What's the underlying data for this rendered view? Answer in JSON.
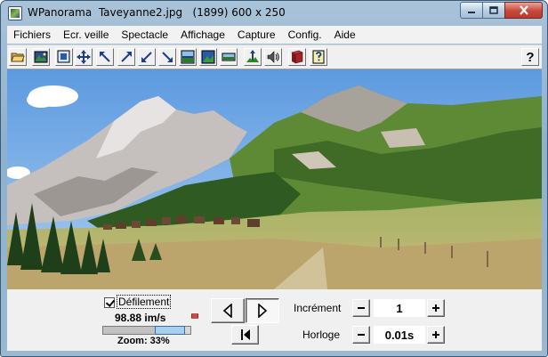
{
  "window": {
    "title": "WPanorama  Taveyanne2.jpg   (1899) 600 x 250",
    "icon": "wpanorama-app-icon"
  },
  "menu": [
    "Fichiers",
    "Ecr. veille",
    "Spectacle",
    "Affichage",
    "Capture",
    "Config.",
    "Aide"
  ],
  "toolbar": {
    "buttons": [
      "open-folder-icon",
      "landscape-image-icon",
      "fit-window-icon",
      "move-arrows-icon",
      "scroll-up-left-icon",
      "scroll-up-right-icon",
      "scroll-down-left-icon",
      "scroll-down-right-icon",
      "image-bottom-icon",
      "image-full-icon",
      "image-strip-icon",
      "adjust-levels-icon",
      "sound-icon",
      "book-icon",
      "help-file-icon"
    ],
    "help_button": "?"
  },
  "panorama": {
    "image": "alpine-valley-panorama-icon"
  },
  "controls": {
    "scroll_checkbox_label": "Défilement",
    "scroll_checked": true,
    "speed": "98.88 im/s",
    "zoom_label": "Zoom: 33%",
    "zoom_fraction": 0.33,
    "increment_label": "Incrément",
    "increment_value": "1",
    "clock_label": "Horloge",
    "clock_value": "0.01s"
  }
}
